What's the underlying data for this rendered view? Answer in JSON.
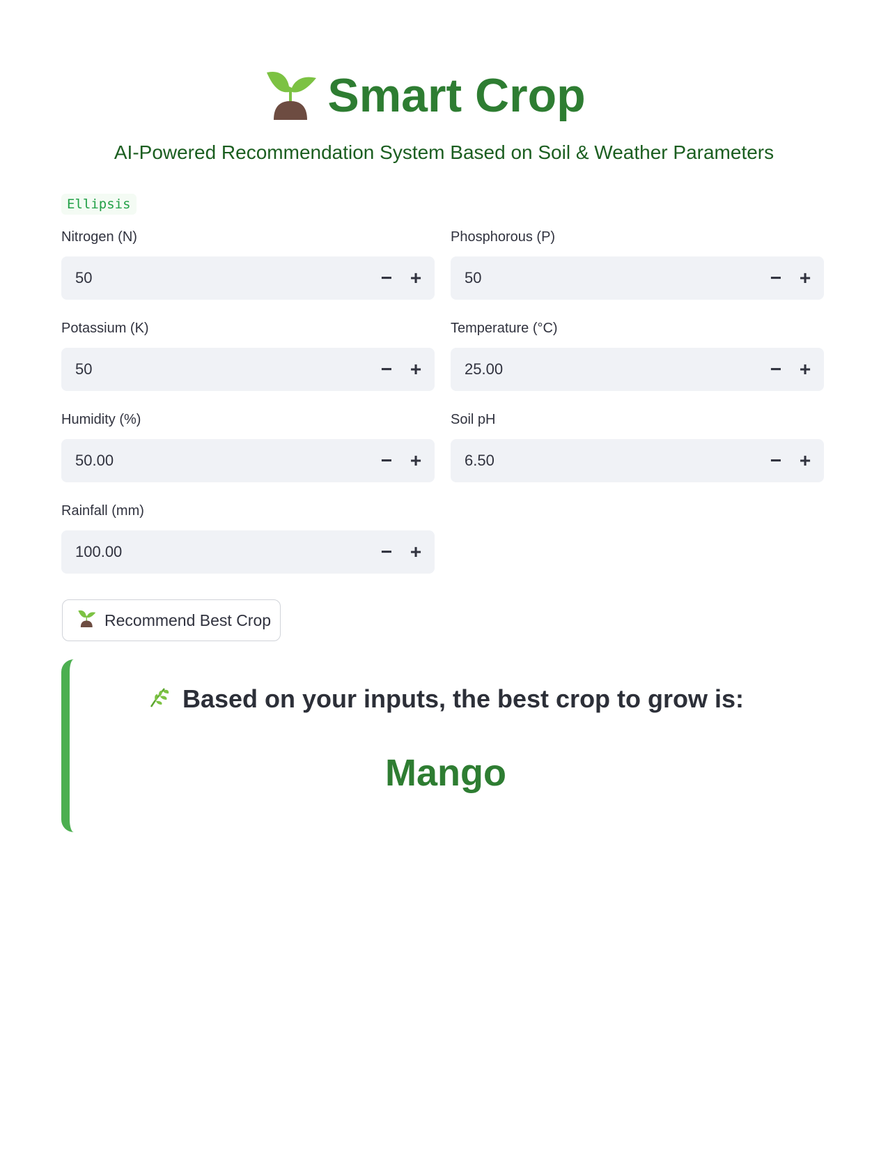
{
  "header": {
    "title": "Smart Crop",
    "subtitle": "AI-Powered Recommendation System Based on Soil & Weather Parameters",
    "title_icon": "seedling-icon",
    "accent_color": "#2e7d32"
  },
  "debug_chip": {
    "text": "Ellipsis",
    "color": "#22a047"
  },
  "fields": {
    "nitrogen": {
      "label": "Nitrogen (N)",
      "value": "50"
    },
    "phosphorous": {
      "label": "Phosphorous (P)",
      "value": "50"
    },
    "potassium": {
      "label": "Potassium (K)",
      "value": "50"
    },
    "temperature": {
      "label": "Temperature (°C)",
      "value": "25.00"
    },
    "humidity": {
      "label": "Humidity (%)",
      "value": "50.00"
    },
    "soil_ph": {
      "label": "Soil pH",
      "value": "6.50"
    },
    "rainfall": {
      "label": "Rainfall (mm)",
      "value": "100.00"
    }
  },
  "stepper": {
    "minus": "−",
    "plus": "+"
  },
  "recommend_button": {
    "label": "Recommend Best Crop",
    "icon": "seedling-icon"
  },
  "result": {
    "heading": "Based on your inputs, the best crop to grow is:",
    "crop": "Mango",
    "heading_icon": "herb-icon",
    "accent_color": "#4caf50"
  }
}
